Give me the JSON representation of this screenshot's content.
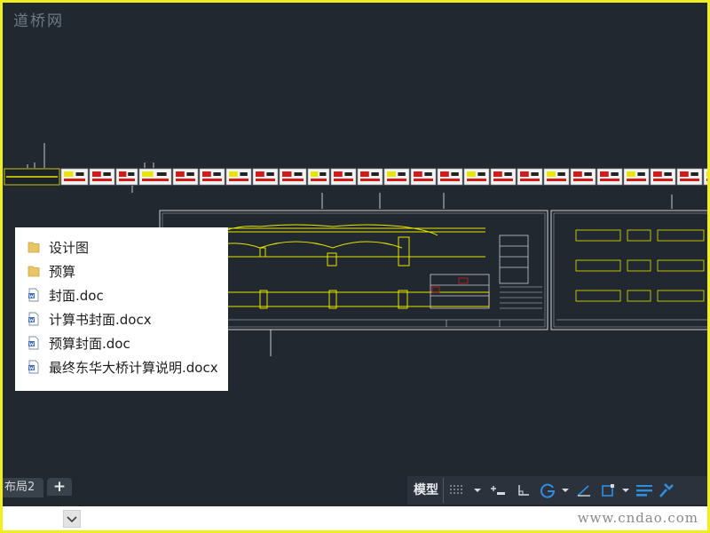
{
  "watermark_top": "道桥网",
  "file_list": [
    {
      "label": "设计图",
      "icon": "folder-icon",
      "color": "#e8c565"
    },
    {
      "label": "预算",
      "icon": "folder-icon",
      "color": "#e8c565"
    },
    {
      "label": "封面.doc",
      "icon": "word-doc-icon",
      "color": "#3f6bb5"
    },
    {
      "label": "计算书封面.docx",
      "icon": "word-doc-icon",
      "color": "#3f6bb5"
    },
    {
      "label": "预算封面.doc",
      "icon": "word-doc-icon",
      "color": "#3f6bb5"
    },
    {
      "label": "最终东华大桥计算说明.docx",
      "icon": "word-doc-icon",
      "color": "#3f6bb5"
    }
  ],
  "tabs": {
    "layout_tab": "布局2",
    "add_tab": "+"
  },
  "statusbar": {
    "model_label": "模型",
    "icons": [
      "grid-icon",
      "dropdown-icon",
      "snap-icon",
      "ortho-icon",
      "polar-tracking-icon",
      "dropdown-icon",
      "isodraft-icon",
      "object-snap-icon",
      "dropdown-icon",
      "lineweight-icon",
      "customize-icon"
    ]
  },
  "watermark_bottom": "www.cndao.com",
  "colors": {
    "background": "#212830",
    "frame": "#f0ee1e",
    "drawing_line": "#c9c9c9",
    "drawing_accent": "#e6e600",
    "drawing_red": "#d21c1c"
  }
}
